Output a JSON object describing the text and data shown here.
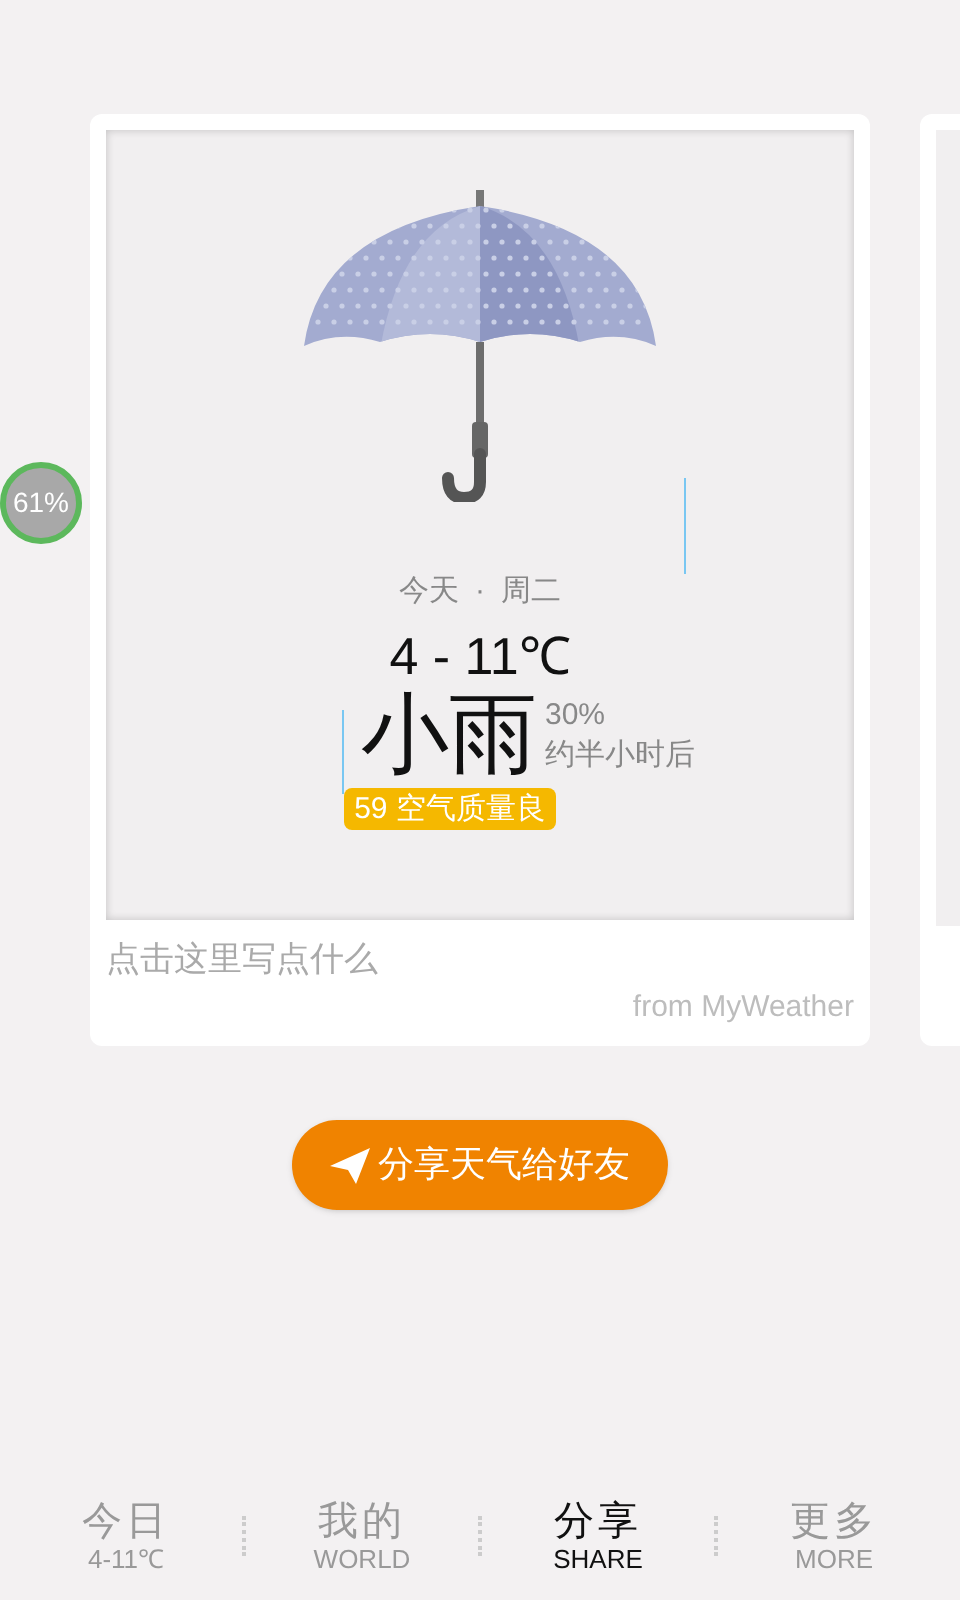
{
  "battery_badge": {
    "text": "61%"
  },
  "card": {
    "day": "今天",
    "separator": "·",
    "weekday": "周二",
    "temperature": "4 - 11℃",
    "condition": "小雨",
    "probability": "30%",
    "forecast_time": "约半小时后",
    "aqi": "59 空气质量良",
    "note_placeholder": "点击这里写点什么",
    "source": "from MyWeather"
  },
  "share_button": {
    "label": "分享天气给好友"
  },
  "nav": [
    {
      "title": "今日",
      "subtitle": "4-11℃",
      "selected": false
    },
    {
      "title": "我的",
      "subtitle": "WORLD",
      "selected": false
    },
    {
      "title": "分享",
      "subtitle": "SHARE",
      "selected": true
    },
    {
      "title": "更多",
      "subtitle": "MORE",
      "selected": false
    }
  ]
}
